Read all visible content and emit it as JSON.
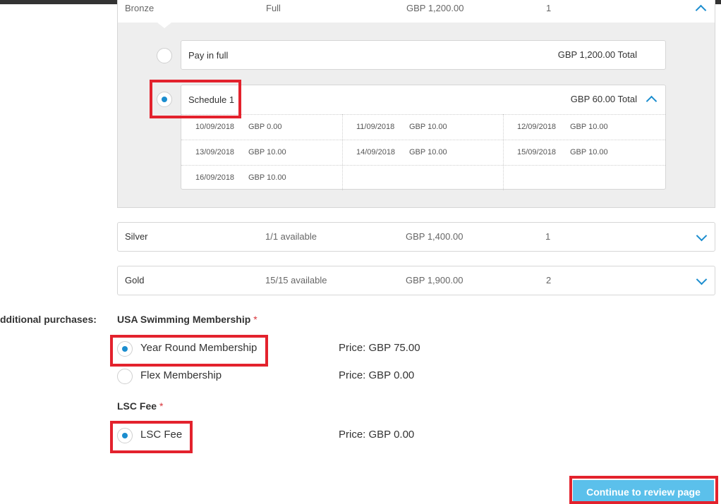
{
  "bronze": {
    "name": "Bronze",
    "availability": "Full",
    "price": "GBP 1,200.00",
    "qty": "1",
    "options": {
      "full": {
        "label": "Pay in full",
        "total": "GBP 1,200.00 Total"
      },
      "schedule": {
        "label": "Schedule 1",
        "total": "GBP 60.00 Total",
        "payments": [
          {
            "date": "10/09/2018",
            "amount": "GBP 0.00"
          },
          {
            "date": "11/09/2018",
            "amount": "GBP 10.00"
          },
          {
            "date": "12/09/2018",
            "amount": "GBP 10.00"
          },
          {
            "date": "13/09/2018",
            "amount": "GBP 10.00"
          },
          {
            "date": "14/09/2018",
            "amount": "GBP 10.00"
          },
          {
            "date": "15/09/2018",
            "amount": "GBP 10.00"
          },
          {
            "date": "16/09/2018",
            "amount": "GBP 10.00"
          }
        ]
      }
    }
  },
  "tiers": [
    {
      "name": "Silver",
      "availability": "1/1 available",
      "price": "GBP 1,400.00",
      "qty": "1"
    },
    {
      "name": "Gold",
      "availability": "15/15 available",
      "price": "GBP 1,900.00",
      "qty": "2"
    }
  ],
  "additional": {
    "label": "dditional purchases:",
    "usa": {
      "title": "USA Swimming Membership",
      "required_mark": "*",
      "choices": [
        {
          "label": "Year Round Membership",
          "price": "Price: GBP 75.00",
          "selected": true
        },
        {
          "label": "Flex Membership",
          "price": "Price: GBP 0.00",
          "selected": false
        }
      ]
    },
    "lsc": {
      "title": "LSC Fee",
      "required_mark": "*",
      "choices": [
        {
          "label": "LSC Fee",
          "price": "Price: GBP 0.00",
          "selected": true
        }
      ]
    }
  },
  "cta": {
    "label": "Continue to review page"
  },
  "colors": {
    "accent": "#1b8dcf",
    "highlight": "#e3222d",
    "cta": "#5bc0eb"
  },
  "icons": {
    "expand": "chevron-down-icon",
    "collapse": "chevron-up-icon"
  }
}
